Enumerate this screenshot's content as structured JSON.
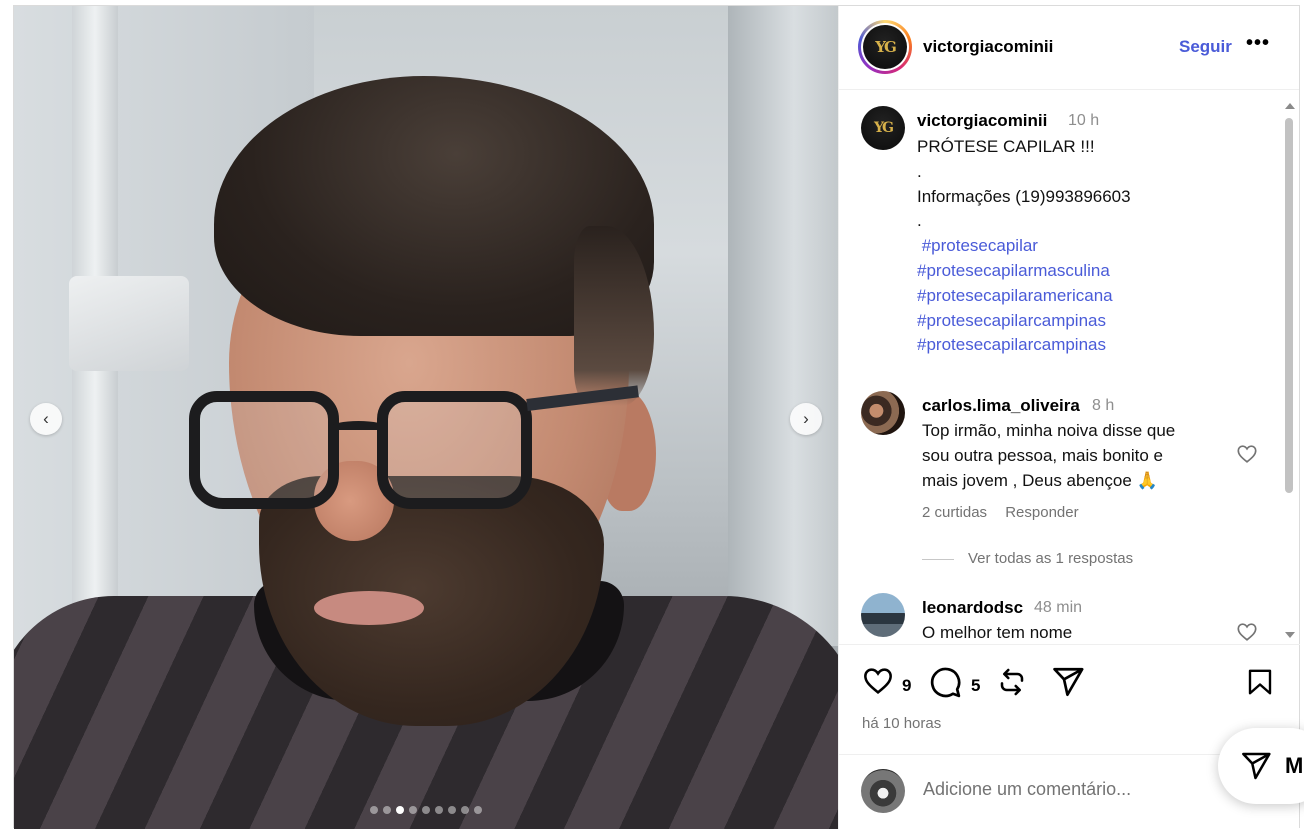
{
  "post": {
    "username": "victorgiacominii",
    "follow_label": "Seguir",
    "more_label": "•••",
    "avatar_monogram": "YG",
    "caption": {
      "username": "victorgiacominii",
      "time": "10 h",
      "lines": [
        "PRÓTESE CAPILAR !!!",
        ".",
        "Informações (19)993896603",
        "."
      ],
      "hashtags": [
        " #protesecapilar",
        "#protesecapilarmasculina",
        "#protesecapilaramericana",
        "#protesecapilarcampinas",
        "#protesecapilarcampinas"
      ]
    },
    "comments": [
      {
        "username": "carlos.lima_oliveira",
        "time": "8 h",
        "lines": [
          "Top irmão, minha noiva disse que",
          "sou outra pessoa, mais bonito e",
          "mais jovem , Deus abençoe 🙏"
        ],
        "likes": "2 curtidas",
        "reply_label": "Responder",
        "view_replies": "Ver todas as 1 respostas"
      },
      {
        "username": "leonardodsc",
        "time": "48 min",
        "lines": [
          "O melhor tem nome"
        ]
      }
    ],
    "actions": {
      "like_count": "9",
      "comment_count": "5",
      "posted_ago": "há 10 horas"
    },
    "add_comment_placeholder": "Adicione um comentário...",
    "carousel": {
      "total_slides": 9,
      "active_index": 2,
      "prev_glyph": "‹",
      "next_glyph": "›"
    }
  },
  "messages_pill": {
    "label": "M"
  },
  "colors": {
    "link": "#4a5bd8",
    "muted": "#737373",
    "border": "#dbdbdb"
  }
}
